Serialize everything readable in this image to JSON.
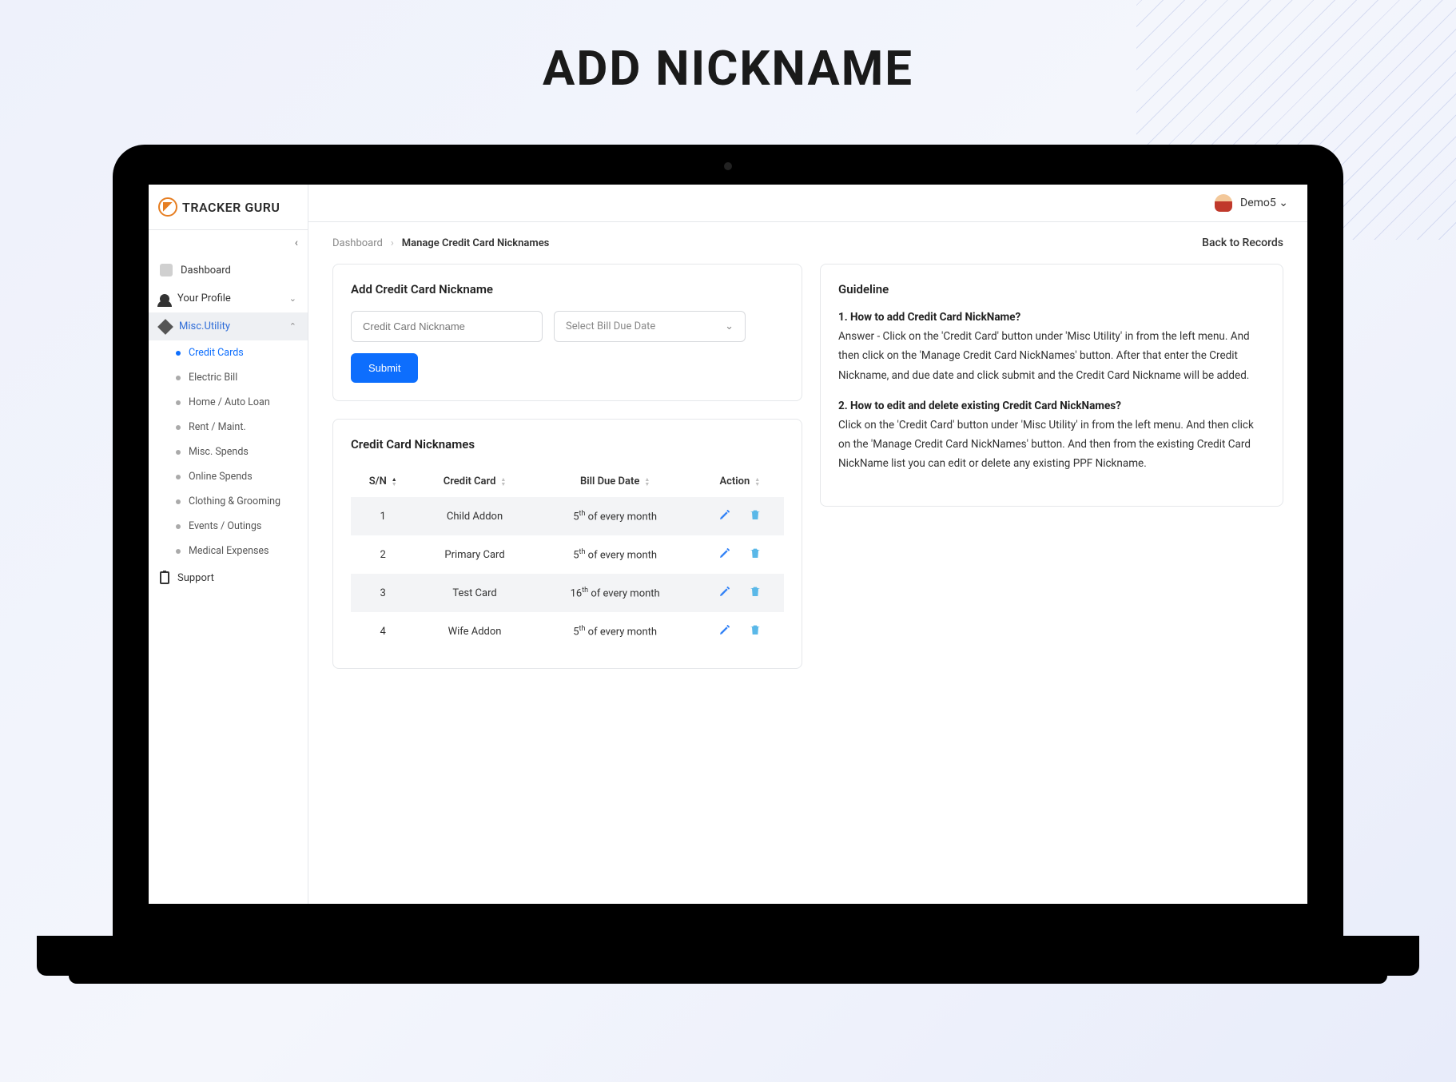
{
  "page_heading": "ADD NICKNAME",
  "brand": "TRACKER GURU",
  "user": {
    "name": "Demo5"
  },
  "sidebar": {
    "dashboard": "Dashboard",
    "profile": "Your Profile",
    "misc_utility": "Misc.Utility",
    "support": "Support",
    "sub": {
      "credit_cards": "Credit Cards",
      "electric_bill": "Electric Bill",
      "home_auto_loan": "Home / Auto Loan",
      "rent_maint": "Rent / Maint.",
      "misc_spends": "Misc. Spends",
      "online_spends": "Online Spends",
      "clothing_grooming": "Clothing & Grooming",
      "events_outings": "Events / Outings",
      "medical_expenses": "Medical Expenses"
    }
  },
  "breadcrumb": {
    "root": "Dashboard",
    "current": "Manage Credit Card Nicknames",
    "back": "Back to Records"
  },
  "form": {
    "title": "Add Credit Card Nickname",
    "nickname_placeholder": "Credit Card Nickname",
    "due_date_placeholder": "Select Bill Due Date",
    "submit": "Submit"
  },
  "table": {
    "title": "Credit Card Nicknames",
    "headers": {
      "sn": "S/N",
      "card": "Credit Card",
      "due": "Bill Due Date",
      "action": "Action"
    },
    "suffix": " of every month",
    "rows": [
      {
        "sn": "1",
        "name": "Child Addon",
        "day": "5",
        "ord": "th"
      },
      {
        "sn": "2",
        "name": "Primary Card",
        "day": "5",
        "ord": "th"
      },
      {
        "sn": "3",
        "name": "Test Card",
        "day": "16",
        "ord": "th"
      },
      {
        "sn": "4",
        "name": "Wife Addon",
        "day": "5",
        "ord": "th"
      }
    ]
  },
  "guideline": {
    "title": "Guideline",
    "q1": "1. How to add Credit Card NickName?",
    "a1": "Answer - Click on the 'Credit Card' button under 'Misc Utility' in from the left menu.\nAnd then click on the 'Manage Credit Card NickNames' button.\nAfter that enter the Credit Nickname, and due date and click submit and the Credit Card Nickname will be added.",
    "q2": "2. How to edit and delete existing Credit Card NickNames?",
    "a2": "Click on the 'Credit Card' button under 'Misc Utility' in from the left menu.\nAnd then click on the 'Manage Credit Card NickNames' button.\nAnd then from the existing Credit Card NickName list you can edit or delete any existing PPF Nickname."
  }
}
